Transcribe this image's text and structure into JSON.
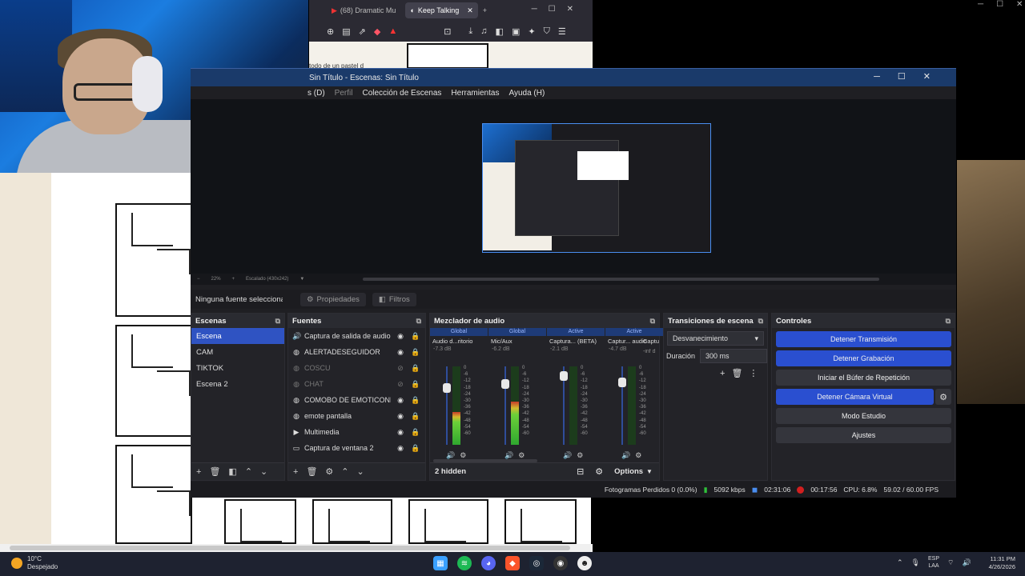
{
  "browser": {
    "tabs": [
      {
        "label": "(68) Dramatic Mu"
      },
      {
        "label": "Keep Talking"
      }
    ],
    "page_text": "todo de un pastel d"
  },
  "obs": {
    "window_title": "Sin Título - Escenas: Sin Título",
    "menu": [
      "s (D)",
      "Perfil",
      "Colección de Escenas",
      "Herramientas",
      "Ayuda (H)"
    ],
    "zoom": {
      "level": "22%",
      "scaled": "Escalado (430x242)"
    },
    "props_bar": {
      "no_source": "Ninguna fuente seleccionad",
      "properties": "Propiedades",
      "filters": "Filtros"
    },
    "scenes": {
      "title": "Escenas",
      "items": [
        {
          "label": "Escena",
          "selected": true
        },
        {
          "label": "CAM",
          "selected": false
        },
        {
          "label": "TIKTOK",
          "selected": false
        },
        {
          "label": "Escena 2",
          "selected": false
        }
      ]
    },
    "sources": {
      "title": "Fuentes",
      "items": [
        {
          "label": "Captura de salida de audio",
          "icon": "speaker-icon",
          "visible": true
        },
        {
          "label": "ALERTADESEGUIDOR",
          "icon": "globe-icon",
          "visible": true
        },
        {
          "label": "COSCU",
          "icon": "globe-icon",
          "visible": false
        },
        {
          "label": "CHAT",
          "icon": "globe-icon",
          "visible": false
        },
        {
          "label": "COMOBO DE EMOTICONES",
          "icon": "globe-icon",
          "visible": true
        },
        {
          "label": "emote pantalla",
          "icon": "globe-icon",
          "visible": true
        },
        {
          "label": "Multimedia",
          "icon": "play-icon",
          "visible": true
        },
        {
          "label": "Captura de ventana 2",
          "icon": "window-icon",
          "visible": true
        }
      ]
    },
    "mixer": {
      "title": "Mezclador de audio",
      "channels": [
        {
          "badge": "Global",
          "name": "Audio d...ritorio",
          "db": "-7.3 dB",
          "level": 0.42,
          "fader": 0.72
        },
        {
          "badge": "Global",
          "name": "Mic/Aux",
          "db": "-6.2 dB",
          "level": 0.55,
          "fader": 0.78
        },
        {
          "badge": "Active",
          "name": "Captura... (BETA)",
          "db": "-2.1 dB",
          "level": 0.0,
          "fader": 0.88
        },
        {
          "badge": "Active",
          "name": "Captur... audio",
          "db": "-4.7 dB",
          "level": 0.0,
          "fader": 0.8
        }
      ],
      "partial_channel": {
        "name": "Captu",
        "db": "-inf d"
      },
      "scale": [
        "0",
        "-6",
        "-12",
        "-18",
        "-24",
        "-30",
        "-36",
        "-42",
        "-48",
        "-54",
        "-60"
      ],
      "hidden": "2 hidden",
      "options": "Options"
    },
    "transitions": {
      "title": "Transiciones de escena",
      "selected": "Desvanecimiento",
      "duration_label": "Duración",
      "duration_value": "300 ms"
    },
    "controls": {
      "title": "Controles",
      "stop_stream": "Detener Transmisión",
      "stop_record": "Detener Grabación",
      "replay": "Iniciar el Búfer de Repetición",
      "stop_vcam": "Detener Cámara Virtual",
      "studio": "Modo Estudio",
      "settings": "Ajustes"
    },
    "status": {
      "dropped": "Fotogramas Perdidos 0 (0.0%)",
      "bitrate": "5092 kbps",
      "stream_time": "02:31:06",
      "rec_time": "00:17:56",
      "cpu": "CPU: 6.8%",
      "fps": "59.02 / 60.00 FPS"
    }
  },
  "taskbar": {
    "weather_temp": "10°C",
    "weather_desc": "Despejado",
    "lang_top": "ESP",
    "lang_bottom": "LAA",
    "time": "11:31 PM",
    "date": "4/26/2026"
  },
  "colors": {
    "accent": "#2f53c2",
    "rec": "#d21f1f",
    "net": "#2fc03a"
  }
}
